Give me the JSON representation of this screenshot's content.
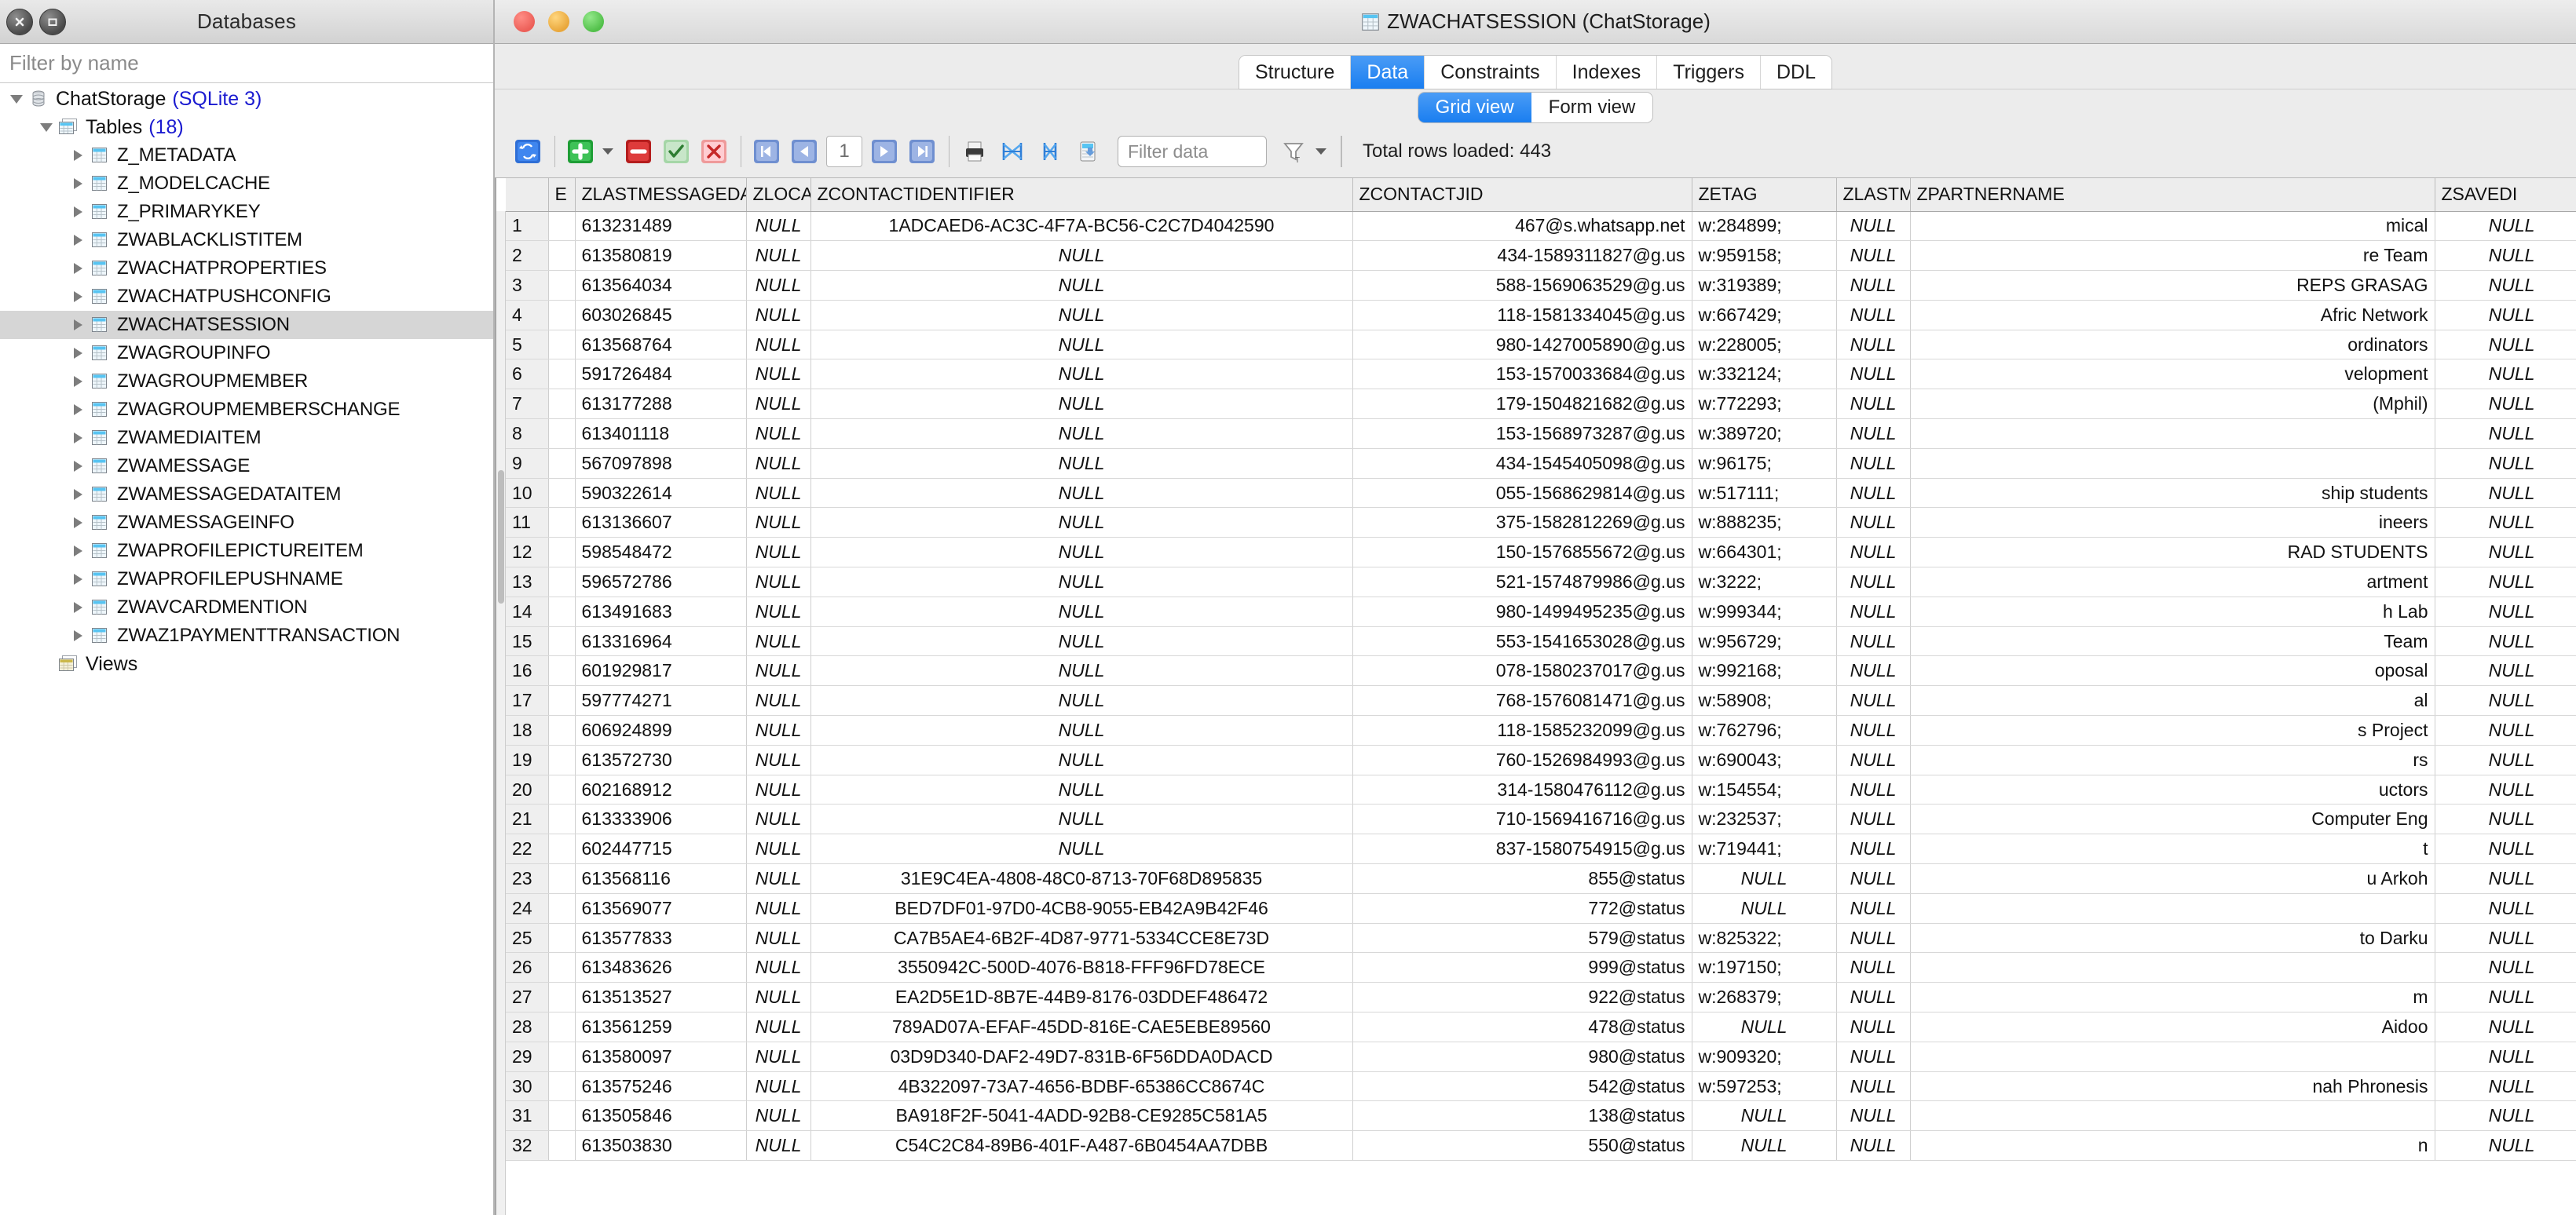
{
  "sidebar": {
    "title": "Databases",
    "close_icon": "close-icon",
    "restore_icon": "restore-icon",
    "filter_placeholder": "Filter by name",
    "filter_value": "",
    "database": {
      "name": "ChatStorage",
      "engine": "(SQLite 3)",
      "icon": "database-icon"
    },
    "tables_group": {
      "label": "Tables",
      "count": "(18)",
      "icon": "tables-icon"
    },
    "tables": [
      "Z_METADATA",
      "Z_MODELCACHE",
      "Z_PRIMARYKEY",
      "ZWABLACKLISTITEM",
      "ZWACHATPROPERTIES",
      "ZWACHATPUSHCONFIG",
      "ZWACHATSESSION",
      "ZWAGROUPINFO",
      "ZWAGROUPMEMBER",
      "ZWAGROUPMEMBERSCHANGE",
      "ZWAMEDIAITEM",
      "ZWAMESSAGE",
      "ZWAMESSAGEDATAITEM",
      "ZWAMESSAGEINFO",
      "ZWAPROFILEPICTUREITEM",
      "ZWAPROFILEPUSHNAME",
      "ZWAVCARDMENTION",
      "ZWAZ1PAYMENTTRANSACTION"
    ],
    "selected_table": "ZWACHATSESSION",
    "views_label": "Views",
    "views_icon": "views-icon"
  },
  "window": {
    "title": "ZWACHATSESSION (ChatStorage)",
    "title_icon": "table-icon",
    "close_button": "close-button",
    "minimize_button": "minimize-button",
    "zoom_button": "zoom-button"
  },
  "tabs": {
    "items": [
      "Structure",
      "Data",
      "Constraints",
      "Indexes",
      "Triggers",
      "DDL"
    ],
    "active": "Data"
  },
  "view_toggle": {
    "items": [
      "Grid view",
      "Form view"
    ],
    "active": "Grid view"
  },
  "toolbar": {
    "refresh_icon": "refresh-icon",
    "add_row_icon": "add-row-icon",
    "add_row_menu_icon": "chevron-down-icon",
    "delete_row_icon": "delete-row-icon",
    "commit_icon": "commit-check-icon",
    "rollback_icon": "rollback-x-icon",
    "first_page_icon": "first-page-icon",
    "prev_page_icon": "previous-page-icon",
    "page_value": "1",
    "next_page_icon": "next-page-icon",
    "last_page_icon": "last-page-icon",
    "print_icon": "print-icon",
    "collapse_columns_icon": "collapse-columns-icon",
    "expand_columns_icon": "expand-columns-icon",
    "export_icon": "export-icon",
    "filter_placeholder": "Filter data",
    "filter_value": "",
    "filter_type_icon": "filter-funnel-icon",
    "filter_menu_icon": "chevron-down-icon",
    "rows_loaded": "Total rows loaded: 443"
  },
  "grid": {
    "columns": [
      "E",
      "ZLASTMESSAGEDATE",
      "ZLOCATI",
      "ZCONTACTIDENTIFIER",
      "ZCONTACTJID",
      "ZETAG",
      "ZLASTM",
      "ZPARTNERNAME",
      "ZSAVEDI"
    ],
    "rows": [
      {
        "n": "1",
        "e": "",
        "lmd": "613231489",
        "loc": "NULL",
        "cid": "1ADCAED6-AC3C-4F7A-BC56-C2C7D4042590",
        "jid": "467@s.whatsapp.net",
        "etag": "w:284899;",
        "lastm": "NULL",
        "pname": "mical",
        "saved": "NULL"
      },
      {
        "n": "2",
        "e": "",
        "lmd": "613580819",
        "loc": "NULL",
        "cid": "NULL",
        "jid": "434-1589311827@g.us",
        "etag": "w:959158;",
        "lastm": "NULL",
        "pname": "re Team",
        "saved": "NULL"
      },
      {
        "n": "3",
        "e": "",
        "lmd": "613564034",
        "loc": "NULL",
        "cid": "NULL",
        "jid": "588-1569063529@g.us",
        "etag": "w:319389;",
        "lastm": "NULL",
        "pname": " REPS GRASAG",
        "saved": "NULL"
      },
      {
        "n": "4",
        "e": "",
        "lmd": "603026845",
        "loc": "NULL",
        "cid": "NULL",
        "jid": "118-1581334045@g.us",
        "etag": "w:667429;",
        "lastm": "NULL",
        "pname": "Afric Network",
        "saved": "NULL"
      },
      {
        "n": "5",
        "e": "",
        "lmd": "613568764",
        "loc": "NULL",
        "cid": "NULL",
        "jid": "980-1427005890@g.us",
        "etag": "w:228005;",
        "lastm": "NULL",
        "pname": "ordinators",
        "saved": "NULL"
      },
      {
        "n": "6",
        "e": "",
        "lmd": "591726484",
        "loc": "NULL",
        "cid": "NULL",
        "jid": "153-1570033684@g.us",
        "etag": "w:332124;",
        "lastm": "NULL",
        "pname": "velopment",
        "saved": "NULL"
      },
      {
        "n": "7",
        "e": "",
        "lmd": "613177288",
        "loc": "NULL",
        "cid": "NULL",
        "jid": "179-1504821682@g.us",
        "etag": "w:772293;",
        "lastm": "NULL",
        "pname": " (Mphil)",
        "saved": "NULL"
      },
      {
        "n": "8",
        "e": "",
        "lmd": "613401118",
        "loc": "NULL",
        "cid": "NULL",
        "jid": "153-1568973287@g.us",
        "etag": "w:389720;",
        "lastm": "NULL",
        "pname": "",
        "saved": "NULL"
      },
      {
        "n": "9",
        "e": "",
        "lmd": "567097898",
        "loc": "NULL",
        "cid": "NULL",
        "jid": "434-1545405098@g.us",
        "etag": "w:96175;",
        "lastm": "NULL",
        "pname": "",
        "saved": "NULL"
      },
      {
        "n": "10",
        "e": "",
        "lmd": "590322614",
        "loc": "NULL",
        "cid": "NULL",
        "jid": "055-1568629814@g.us",
        "etag": "w:517111;",
        "lastm": "NULL",
        "pname": "ship students",
        "saved": "NULL"
      },
      {
        "n": "11",
        "e": "",
        "lmd": "613136607",
        "loc": "NULL",
        "cid": "NULL",
        "jid": "375-1582812269@g.us",
        "etag": "w:888235;",
        "lastm": "NULL",
        "pname": "ineers",
        "saved": "NULL"
      },
      {
        "n": "12",
        "e": "",
        "lmd": "598548472",
        "loc": "NULL",
        "cid": "NULL",
        "jid": "150-1576855672@g.us",
        "etag": "w:664301;",
        "lastm": "NULL",
        "pname": "RAD STUDENTS",
        "saved": "NULL"
      },
      {
        "n": "13",
        "e": "",
        "lmd": "596572786",
        "loc": "NULL",
        "cid": "NULL",
        "jid": "521-1574879986@g.us",
        "etag": "w:3222;",
        "lastm": "NULL",
        "pname": "artment",
        "saved": "NULL"
      },
      {
        "n": "14",
        "e": "",
        "lmd": "613491683",
        "loc": "NULL",
        "cid": "NULL",
        "jid": "980-1499495235@g.us",
        "etag": "w:999344;",
        "lastm": "NULL",
        "pname": "h Lab",
        "saved": "NULL"
      },
      {
        "n": "15",
        "e": "",
        "lmd": "613316964",
        "loc": "NULL",
        "cid": "NULL",
        "jid": "553-1541653028@g.us",
        "etag": "w:956729;",
        "lastm": "NULL",
        "pname": "Team",
        "saved": "NULL"
      },
      {
        "n": "16",
        "e": "",
        "lmd": "601929817",
        "loc": "NULL",
        "cid": "NULL",
        "jid": "078-1580237017@g.us",
        "etag": "w:992168;",
        "lastm": "NULL",
        "pname": "oposal",
        "saved": "NULL"
      },
      {
        "n": "17",
        "e": "",
        "lmd": "597774271",
        "loc": "NULL",
        "cid": "NULL",
        "jid": "768-1576081471@g.us",
        "etag": "w:58908;",
        "lastm": "NULL",
        "pname": "al",
        "saved": "NULL"
      },
      {
        "n": "18",
        "e": "",
        "lmd": "606924899",
        "loc": "NULL",
        "cid": "NULL",
        "jid": "118-1585232099@g.us",
        "etag": "w:762796;",
        "lastm": "NULL",
        "pname": "s Project",
        "saved": "NULL"
      },
      {
        "n": "19",
        "e": "",
        "lmd": "613572730",
        "loc": "NULL",
        "cid": "NULL",
        "jid": "760-1526984993@g.us",
        "etag": "w:690043;",
        "lastm": "NULL",
        "pname": "rs",
        "saved": "NULL"
      },
      {
        "n": "20",
        "e": "",
        "lmd": "602168912",
        "loc": "NULL",
        "cid": "NULL",
        "jid": "314-1580476112@g.us",
        "etag": "w:154554;",
        "lastm": "NULL",
        "pname": "uctors",
        "saved": "NULL"
      },
      {
        "n": "21",
        "e": "",
        "lmd": "613333906",
        "loc": "NULL",
        "cid": "NULL",
        "jid": "710-1569416716@g.us",
        "etag": "w:232537;",
        "lastm": "NULL",
        "pname": " Computer Eng",
        "saved": "NULL"
      },
      {
        "n": "22",
        "e": "",
        "lmd": "602447715",
        "loc": "NULL",
        "cid": "NULL",
        "jid": "837-1580754915@g.us",
        "etag": "w:719441;",
        "lastm": "NULL",
        "pname": "t",
        "saved": "NULL"
      },
      {
        "n": "23",
        "e": "",
        "lmd": "613568116",
        "loc": "NULL",
        "cid": "31E9C4EA-4808-48C0-8713-70F68D895835",
        "jid": "855@status",
        "etag": "NULL",
        "lastm": "NULL",
        "pname": "u Arkoh",
        "saved": "NULL"
      },
      {
        "n": "24",
        "e": "",
        "lmd": "613569077",
        "loc": "NULL",
        "cid": "BED7DF01-97D0-4CB8-9055-EB42A9B42F46",
        "jid": "772@status",
        "etag": "NULL",
        "lastm": "NULL",
        "pname": "",
        "saved": "NULL"
      },
      {
        "n": "25",
        "e": "",
        "lmd": "613577833",
        "loc": "NULL",
        "cid": "CA7B5AE4-6B2F-4D87-9771-5334CCE8E73D",
        "jid": "579@status",
        "etag": "w:825322;",
        "lastm": "NULL",
        "pname": "to Darku",
        "saved": "NULL"
      },
      {
        "n": "26",
        "e": "",
        "lmd": "613483626",
        "loc": "NULL",
        "cid": "3550942C-500D-4076-B818-FFF96FD78ECE",
        "jid": "999@status",
        "etag": "w:197150;",
        "lastm": "NULL",
        "pname": "",
        "saved": "NULL"
      },
      {
        "n": "27",
        "e": "",
        "lmd": "613513527",
        "loc": "NULL",
        "cid": "EA2D5E1D-8B7E-44B9-8176-03DDEF486472",
        "jid": "922@status",
        "etag": "w:268379;",
        "lastm": "NULL",
        "pname": "m",
        "saved": "NULL"
      },
      {
        "n": "28",
        "e": "",
        "lmd": "613561259",
        "loc": "NULL",
        "cid": "789AD07A-EFAF-45DD-816E-CAE5EBE89560",
        "jid": "478@status",
        "etag": "NULL",
        "lastm": "NULL",
        "pname": " Aidoo",
        "saved": "NULL"
      },
      {
        "n": "29",
        "e": "",
        "lmd": "613580097",
        "loc": "NULL",
        "cid": "03D9D340-DAF2-49D7-831B-6F56DDA0DACD",
        "jid": "980@status",
        "etag": "w:909320;",
        "lastm": "NULL",
        "pname": "",
        "saved": "NULL"
      },
      {
        "n": "30",
        "e": "",
        "lmd": "613575246",
        "loc": "NULL",
        "cid": "4B322097-73A7-4656-BDBF-65386CC8674C",
        "jid": "542@status",
        "etag": "w:597253;",
        "lastm": "NULL",
        "pname": "nah Phronesis",
        "saved": "NULL"
      },
      {
        "n": "31",
        "e": "",
        "lmd": "613505846",
        "loc": "NULL",
        "cid": "BA918F2F-5041-4ADD-92B8-CE9285C581A5",
        "jid": "138@status",
        "etag": "NULL",
        "lastm": "NULL",
        "pname": "",
        "saved": "NULL"
      },
      {
        "n": "32",
        "e": "",
        "lmd": "613503830",
        "loc": "NULL",
        "cid": "C54C2C84-89B6-401F-A487-6B0454AA7DBB",
        "jid": "550@status",
        "etag": "NULL",
        "lastm": "NULL",
        "pname": "n",
        "saved": "NULL"
      }
    ]
  },
  "colors": {
    "accent": "#1a7ef0",
    "blue_text": "#1a1ad0",
    "null_text": "#a2a2a2",
    "selection": "#d6d6d6"
  }
}
